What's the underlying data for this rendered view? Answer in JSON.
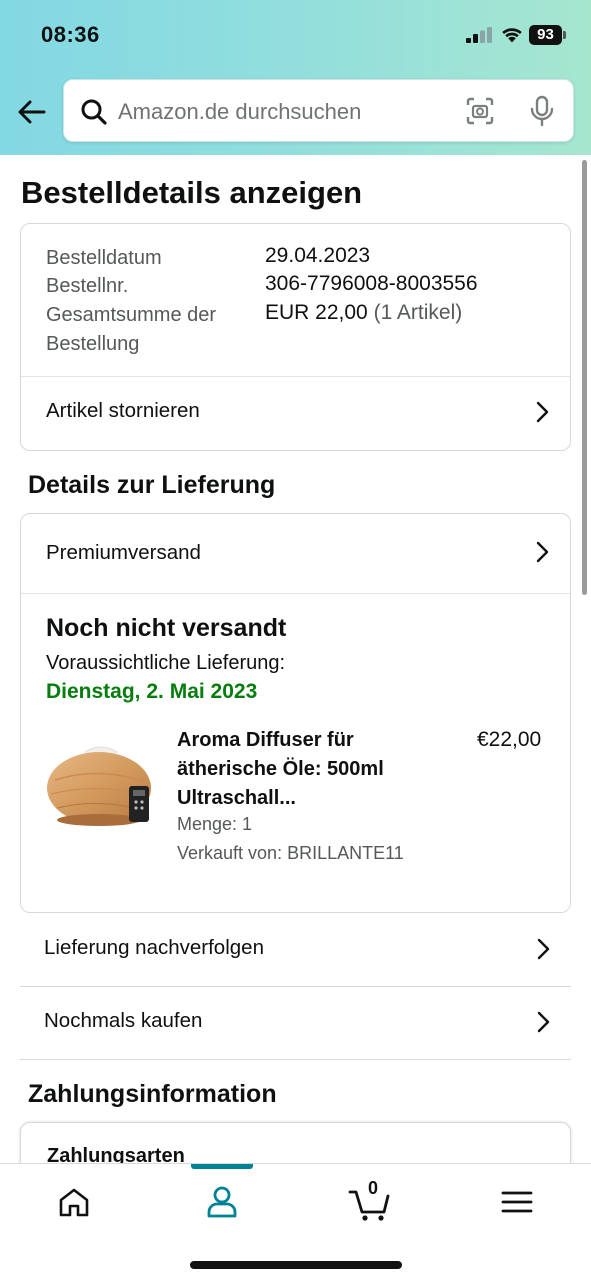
{
  "status_bar": {
    "time": "08:36",
    "battery": "93"
  },
  "search": {
    "placeholder": "Amazon.de durchsuchen"
  },
  "page": {
    "title": "Bestelldetails anzeigen"
  },
  "order_summary": {
    "date_label": "Bestelldatum",
    "date_value": "29.04.2023",
    "number_label": "Bestellnr.",
    "number_value": "306-7796008-8003556",
    "total_label_line1": "Gesamtsumme der",
    "total_label_line2": "Bestellung",
    "total_value": "EUR 22,00",
    "total_items": "(1 Artikel)",
    "cancel_label": "Artikel stornieren"
  },
  "delivery": {
    "section_title": "Details zur Lieferung",
    "shipping_method": "Premiumversand",
    "status_title": "Noch nicht versandt",
    "expected_label": "Voraussichtliche Lieferung:",
    "expected_date": "Dienstag, 2. Mai 2023",
    "product": {
      "name": "Aroma Diffuser für ätherische Öle: 500ml Ultraschall...",
      "price": "€22,00",
      "quantity": "Menge: 1",
      "seller": "Verkauft von: BRILLANTE11"
    }
  },
  "actions": {
    "track": "Lieferung nachverfolgen",
    "buy_again": "Nochmals kaufen"
  },
  "payment": {
    "section_title": "Zahlungsinformation",
    "methods_label": "Zahlungsarten"
  },
  "bottom_nav": {
    "cart_count": "0",
    "active_tab": "account"
  },
  "colors": {
    "header_gradient_start": "#82d8e3",
    "header_gradient_end": "#a6e6cf",
    "delivery_green": "#067d0e",
    "active_tab": "#008296"
  }
}
